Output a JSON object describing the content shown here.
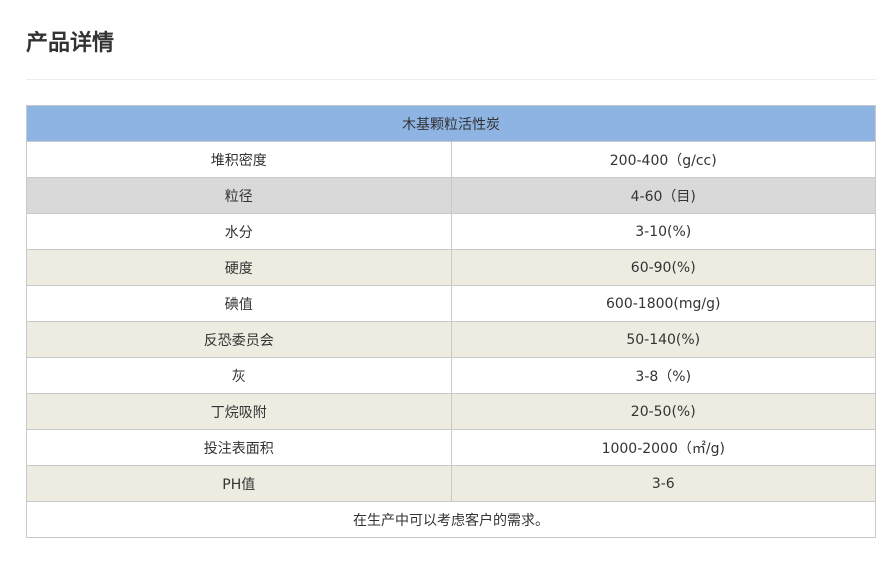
{
  "page": {
    "title": "产品详情"
  },
  "table": {
    "header": "木基颗粒活性炭",
    "rows": [
      {
        "name": "堆积密度",
        "value": "200-400（g/cc)"
      },
      {
        "name": "粒径",
        "value": "4-60（目)"
      },
      {
        "name": "水分",
        "value": "3-10(%)"
      },
      {
        "name": "硬度",
        "value": "60-90(%)"
      },
      {
        "name": "碘值",
        "value": "600-1800(mg/g)"
      },
      {
        "name": "反恐委员会",
        "value": "50-140(%)"
      },
      {
        "name": "灰",
        "value": "3-8（%)"
      },
      {
        "name": "丁烷吸附",
        "value": "20-50(%)"
      },
      {
        "name": "投注表面积",
        "value": "1000-2000（㎡/g)"
      },
      {
        "name": "PH值",
        "value": "3-6"
      }
    ],
    "footer": "在生产中可以考虑客户的需求。"
  },
  "colors": {
    "header_bg": "#8eb4e3",
    "row_grey": "#d9d9d9",
    "row_beige": "#eeece1",
    "border": "#c9c9c9"
  }
}
